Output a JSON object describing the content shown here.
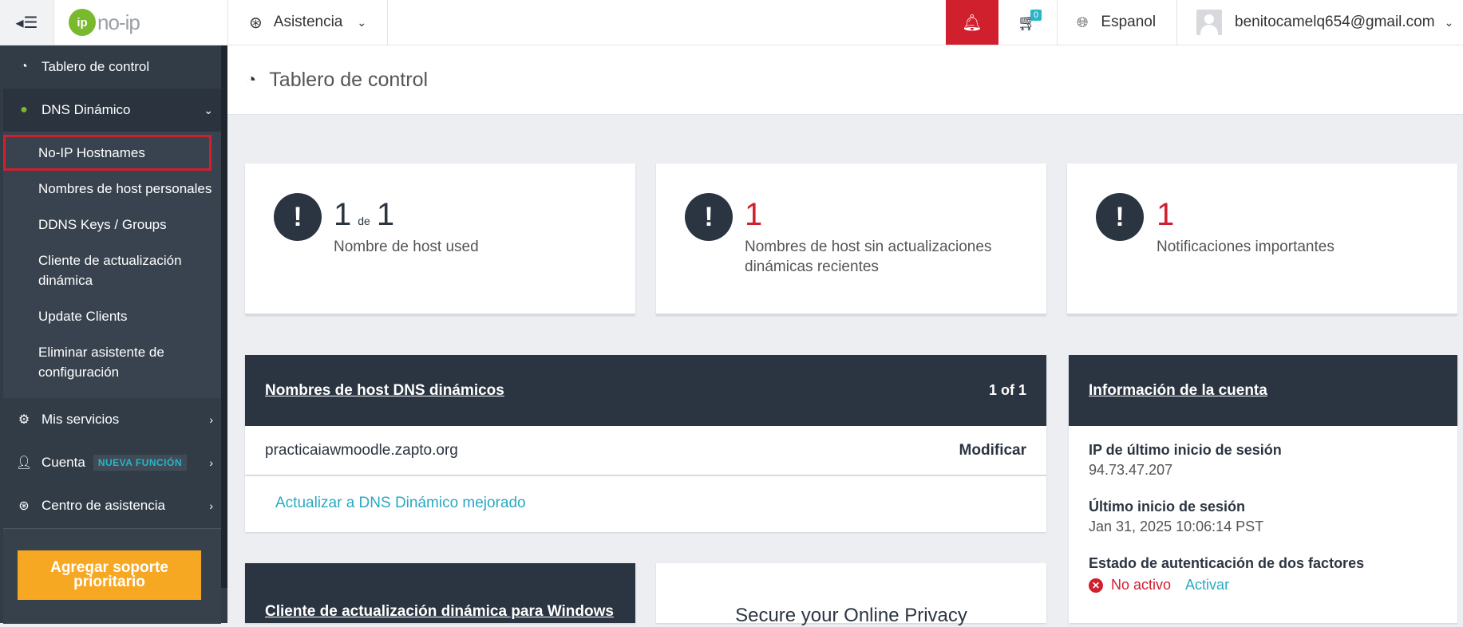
{
  "topbar": {
    "menu_icon": "menu-collapse-icon",
    "logo_mark": "ip",
    "logo_text": "no-ip",
    "assist_label": "Asistencia",
    "cart_count": "0",
    "language": "Espanol",
    "user_email": "benitocamelq654@gmail.com"
  },
  "sidebar": {
    "dashboard": "Tablero de control",
    "dns": "DNS Dinámico",
    "sub_items": [
      "No-IP Hostnames",
      "Nombres de host personales",
      "DDNS Keys / Groups",
      "Cliente de actualización dinámica",
      "Update Clients",
      "Eliminar asistente de configuración"
    ],
    "services": "Mis servicios",
    "account": "Cuenta",
    "new_badge": "NUEVA FUNCIÓN",
    "support_center": "Centro de asistencia",
    "priority_button": "Agregar soporte prioritario"
  },
  "page": {
    "title": "Tablero de control"
  },
  "stats": [
    {
      "value": "1",
      "of": "de",
      "total": "1",
      "label": "Nombre de host used"
    },
    {
      "value": "1",
      "label": "Nombres de host sin actualizaciones dinámicas recientes"
    },
    {
      "value": "1",
      "label": "Notificaciones importantes"
    }
  ],
  "hostnames_panel": {
    "title": "Nombres de host DNS dinámicos",
    "count": "1 of 1",
    "hostname": "practicaiawmoodle.zapto.org",
    "modify": "Modificar",
    "upgrade": "Actualizar a DNS Dinámico mejorado"
  },
  "account_panel": {
    "title": "Información de la cuenta",
    "last_ip_label": "IP de último inicio de sesión",
    "last_ip": "94.73.47.207",
    "last_login_label": "Último inicio de sesión",
    "last_login": "Jan 31, 2025 10:06:14 PST",
    "twofa_label": "Estado de autenticación de dos factores",
    "twofa_status": "No activo",
    "twofa_action": "Activar"
  },
  "windows_panel": {
    "title": "Cliente de actualización dinámica para Windows"
  },
  "promo": {
    "text": "Secure your Online Privacy"
  },
  "colors": {
    "accent_red": "#d0202e",
    "dark": "#2b3541",
    "link": "#29a9c2",
    "orange": "#f7a823",
    "green": "#7ab82d"
  }
}
